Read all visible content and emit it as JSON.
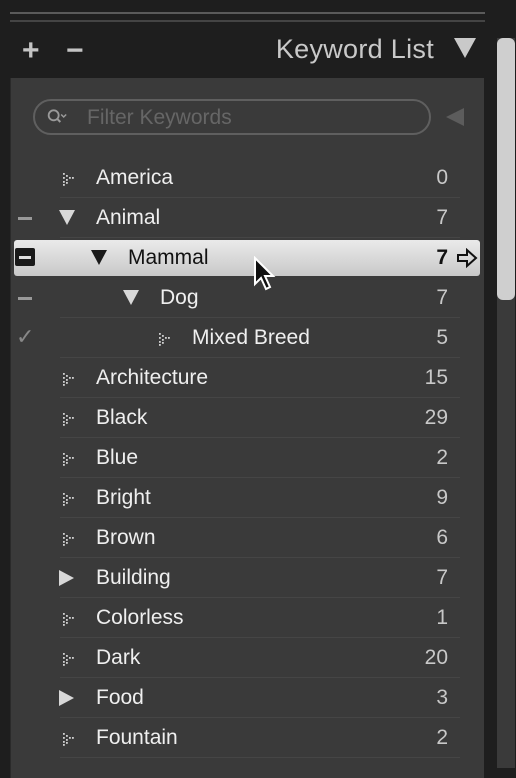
{
  "header": {
    "add_label": "+",
    "remove_label": "−",
    "title": "Keyword List"
  },
  "search": {
    "placeholder": "Filter Keywords",
    "icon": "search-icon"
  },
  "keywords": [
    {
      "name": "America",
      "count": "0",
      "indent": 0,
      "type": "leaf",
      "marker": ""
    },
    {
      "name": "Animal",
      "count": "7",
      "indent": 0,
      "type": "expanded",
      "marker": "minus"
    },
    {
      "name": "Mammal",
      "count": "7",
      "indent": 1,
      "type": "expanded",
      "marker": "minus-boxed",
      "selected": true
    },
    {
      "name": "Dog",
      "count": "7",
      "indent": 2,
      "type": "expanded",
      "marker": "minus"
    },
    {
      "name": "Mixed Breed",
      "count": "5",
      "indent": 3,
      "type": "leaf",
      "marker": "check"
    },
    {
      "name": "Architecture",
      "count": "15",
      "indent": 0,
      "type": "leaf",
      "marker": ""
    },
    {
      "name": "Black",
      "count": "29",
      "indent": 0,
      "type": "leaf",
      "marker": ""
    },
    {
      "name": "Blue",
      "count": "2",
      "indent": 0,
      "type": "leaf",
      "marker": ""
    },
    {
      "name": "Bright",
      "count": "9",
      "indent": 0,
      "type": "leaf",
      "marker": ""
    },
    {
      "name": "Brown",
      "count": "6",
      "indent": 0,
      "type": "leaf",
      "marker": ""
    },
    {
      "name": "Building",
      "count": "7",
      "indent": 0,
      "type": "collapsed",
      "marker": ""
    },
    {
      "name": "Colorless",
      "count": "1",
      "indent": 0,
      "type": "leaf",
      "marker": ""
    },
    {
      "name": "Dark",
      "count": "20",
      "indent": 0,
      "type": "leaf",
      "marker": ""
    },
    {
      "name": "Food",
      "count": "3",
      "indent": 0,
      "type": "collapsed",
      "marker": ""
    },
    {
      "name": "Fountain",
      "count": "2",
      "indent": 0,
      "type": "leaf",
      "marker": ""
    }
  ],
  "colors": {
    "background": "#1e1e1e",
    "panel": "#3a3a3a",
    "text": "#efefef",
    "selected_row": "#dcdcdc"
  }
}
